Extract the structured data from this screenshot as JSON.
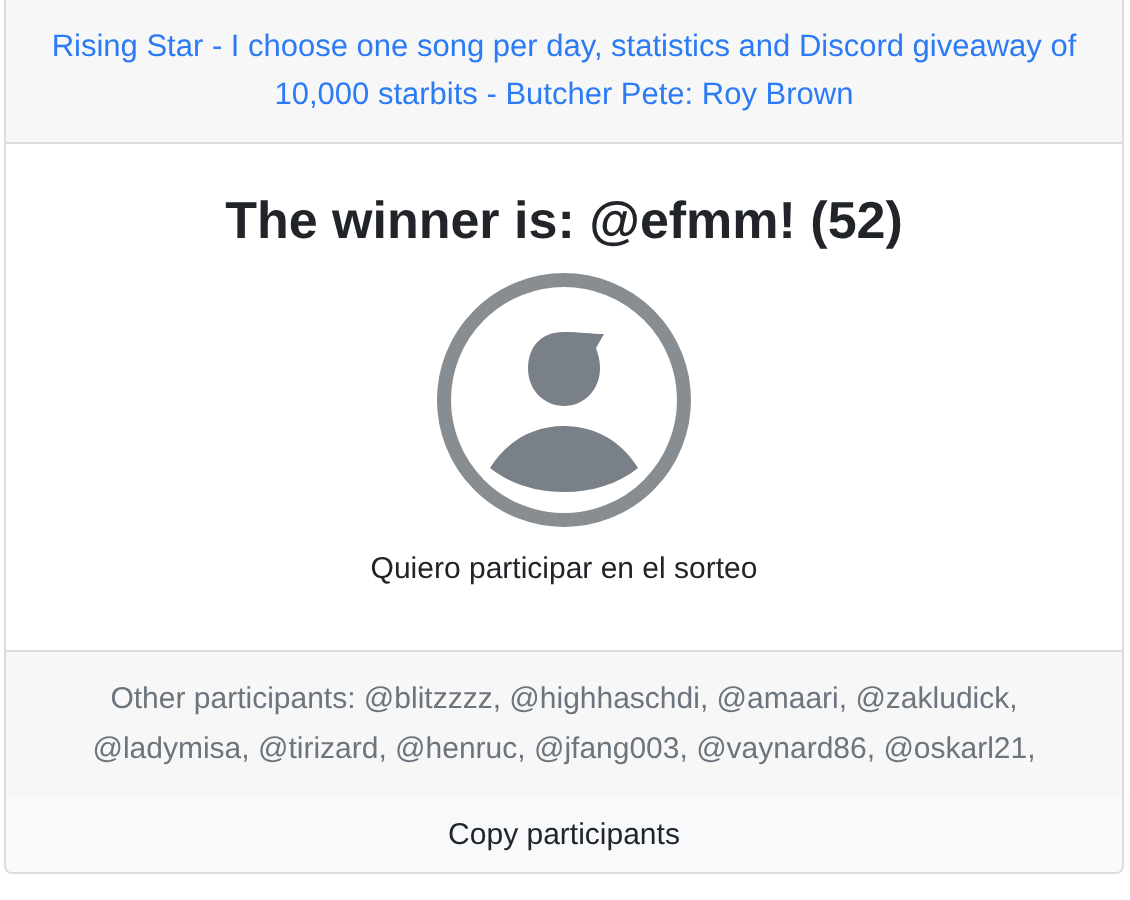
{
  "header": {
    "link": "Rising Star - I choose one song per day, statistics and Discord giveaway of 10,000 starbits - Butcher Pete: Roy Brown"
  },
  "winner": {
    "title": "The winner is: @efmm! (52)",
    "comment": "Quiero participar en el sorteo"
  },
  "participants": {
    "text": "Other participants: @blitzzzz, @highhaschdi, @amaari, @zakludick, @ladymisa, @tirizard, @henruc, @jfang003, @vaynard86, @oskarl21,"
  },
  "buttons": [
    {
      "label": "Copy participants"
    }
  ]
}
